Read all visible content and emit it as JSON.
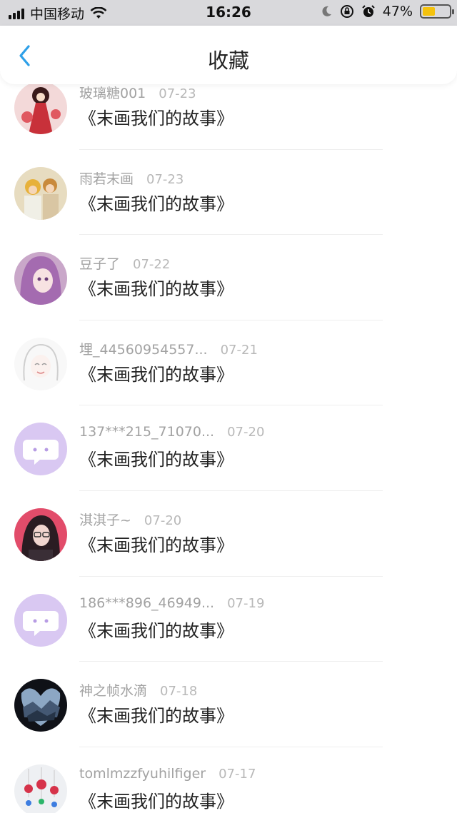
{
  "status_bar": {
    "carrier": "中国移动",
    "time": "16:26",
    "battery": "47%",
    "battery_level": 0.47
  },
  "nav": {
    "title": "收藏"
  },
  "items": [
    {
      "name": "玻璃糖001",
      "date": "07-23",
      "work": "《末画我们的故事》"
    },
    {
      "name": "雨若末画",
      "date": "07-23",
      "work": "《末画我们的故事》"
    },
    {
      "name": "豆子了",
      "date": "07-22",
      "work": "《末画我们的故事》"
    },
    {
      "name": "埋_44560954557...",
      "date": "07-21",
      "work": "《末画我们的故事》"
    },
    {
      "name": "137***215_71070...",
      "date": "07-20",
      "work": "《末画我们的故事》"
    },
    {
      "name": "淇淇子~",
      "date": "07-20",
      "work": "《末画我们的故事》"
    },
    {
      "name": "186***896_46949...",
      "date": "07-19",
      "work": "《末画我们的故事》"
    },
    {
      "name": "神之帧水滴",
      "date": "07-18",
      "work": "《末画我们的故事》"
    },
    {
      "name": "tomlmzzfyuhilfiger",
      "date": "07-17",
      "work": "《末画我们的故事》"
    }
  ],
  "colors": {
    "accent": "#2ea0e8",
    "default_avatar": "#d9c8f2"
  }
}
